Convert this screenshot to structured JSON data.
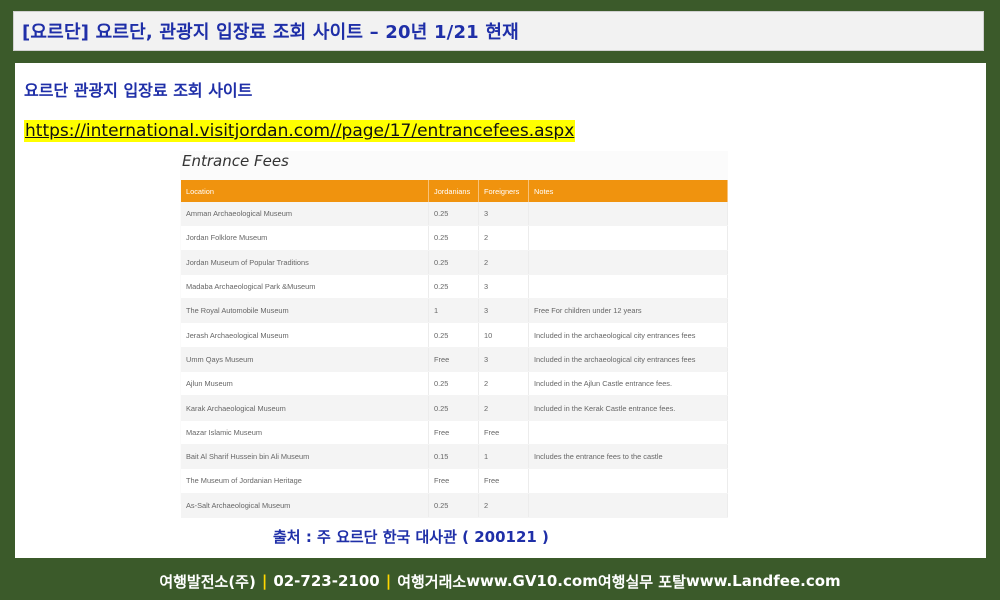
{
  "title": "[요르단] 요르단,  관광지 입장료 조회 사이트  – 20년 1/21 현재",
  "heading": "요르단 관광지 입장료 조회 사이트",
  "url": "https://international.visitjordan.com//page/17/entrancefees.aspx",
  "fees": {
    "title": "Entrance Fees",
    "columns": [
      "Location",
      "Jordanians",
      "Foreigners",
      "Notes"
    ],
    "rows": [
      {
        "location": "Amman Archaeological Museum",
        "jordanians": "0.25",
        "foreigners": "3",
        "notes": ""
      },
      {
        "location": "Jordan Folklore Museum",
        "jordanians": "0.25",
        "foreigners": "2",
        "notes": ""
      },
      {
        "location": "Jordan Museum of Popular Traditions",
        "jordanians": "0.25",
        "foreigners": "2",
        "notes": ""
      },
      {
        "location": "Madaba Archaeological Park &Museum",
        "jordanians": "0.25",
        "foreigners": "3",
        "notes": ""
      },
      {
        "location": "The Royal Automobile Museum",
        "jordanians": "1",
        "foreigners": "3",
        "notes": "Free For children under 12 years"
      },
      {
        "location": "Jerash Archaeological Museum",
        "jordanians": "0.25",
        "foreigners": "10",
        "notes": "Included in the archaeological city entrances fees"
      },
      {
        "location": "Umm Qays Museum",
        "jordanians": "Free",
        "foreigners": "3",
        "notes": "Included in the archaeological city entrances fees"
      },
      {
        "location": "Ajlun Museum",
        "jordanians": "0.25",
        "foreigners": "2",
        "notes": "Included in the Ajlun Castle entrance fees."
      },
      {
        "location": "Karak Archaeological Museum",
        "jordanians": "0.25",
        "foreigners": "2",
        "notes": "Included in the Kerak Castle entrance fees."
      },
      {
        "location": "Mazar Islamic Museum",
        "jordanians": "Free",
        "foreigners": "Free",
        "notes": ""
      },
      {
        "location": "Bait Al Sharif Hussein bin Ali Museum",
        "jordanians": "0.15",
        "foreigners": "1",
        "notes": "Includes the entrance fees to the castle"
      },
      {
        "location": "The Museum of Jordanian Heritage",
        "jordanians": "Free",
        "foreigners": "Free",
        "notes": ""
      },
      {
        "location": "As-Salt Archaeological Museum",
        "jordanians": "0.25",
        "foreigners": "2",
        "notes": ""
      }
    ]
  },
  "source": "출처 : 주 요르단 한국 대사관 ( 200121 )",
  "footer": {
    "agency": "여행발전소(주)",
    "phone": "02-723-2100",
    "site1_label": "여행거래소",
    "site1_url": "www.GV10.com",
    "site2_label": "여행실무 포탈",
    "site2_url": "www.Landfee.com",
    "separator": "|"
  },
  "colors": {
    "background": "#3b5a2a",
    "title_text": "#1f2fa8",
    "table_header": "#f0930e",
    "url_highlight": "#ffff00"
  }
}
